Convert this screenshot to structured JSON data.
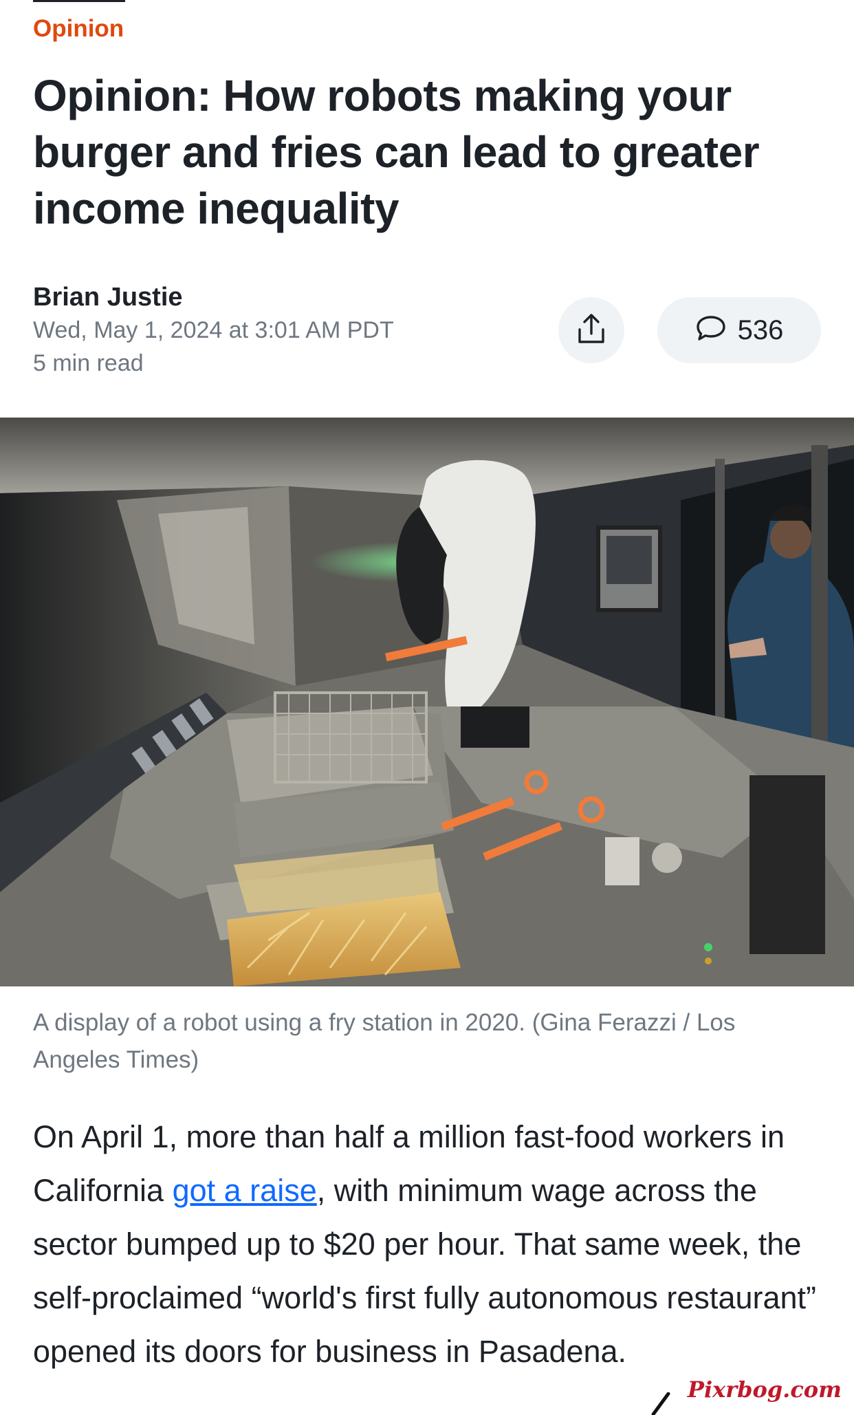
{
  "article": {
    "section": "Opinion",
    "headline": "Opinion: How robots making your burger and fries can lead to greater income inequality",
    "author": "Brian Justie",
    "date": "Wed, May 1, 2024 at 3:01 AM PDT",
    "read_time": "5 min read",
    "comment_count": "536",
    "caption": "A display of a robot using a fry station in 2020. (Gina Ferazzi / Los Angeles Times)",
    "body": {
      "part1": "On April 1, more than half a million fast-food workers in California ",
      "link": "got a raise",
      "part2": ", with minimum wage across the sector bumped up to $20 per hour. That same week, the self-proclaimed “world's first fully autonomous restaurant” opened its doors for business in Pasadena."
    }
  },
  "icons": {
    "share": "share-icon",
    "comment": "comment-bubble-icon"
  },
  "watermark": "Pixrbog.com",
  "colors": {
    "section_label": "#e0480e",
    "link": "#0f69ff",
    "button_bg": "#f0f3f5",
    "text": "#1d2228",
    "muted": "#6e7780"
  }
}
